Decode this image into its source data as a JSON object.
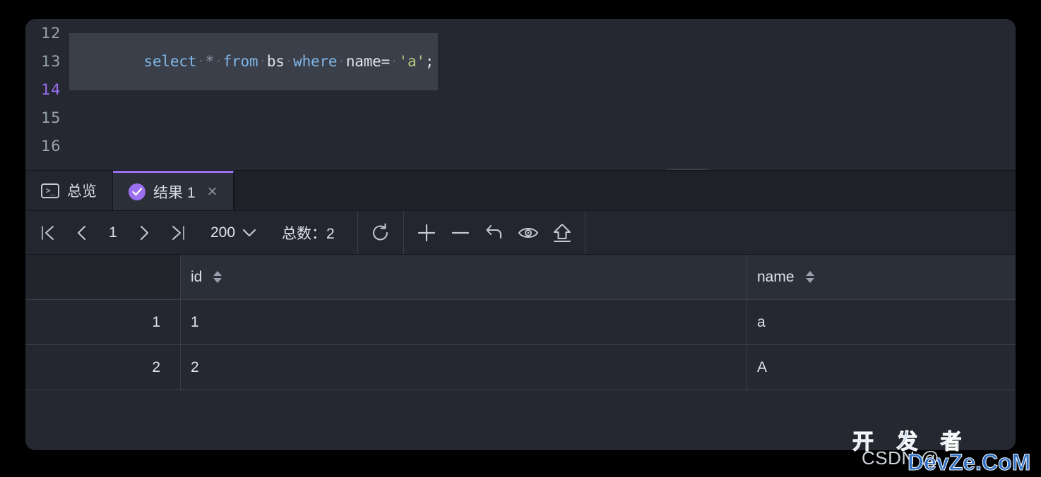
{
  "editor": {
    "lines": [
      {
        "number": "12",
        "current": false,
        "tokens": []
      },
      {
        "number": "13",
        "current": false,
        "highlighted": true,
        "tokens": [
          {
            "t": "select",
            "c": "kw"
          },
          {
            "t": "·",
            "c": "ws"
          },
          {
            "t": "*",
            "c": "op"
          },
          {
            "t": "·",
            "c": "ws"
          },
          {
            "t": "from",
            "c": "kw"
          },
          {
            "t": "·",
            "c": "ws"
          },
          {
            "t": "bs",
            "c": "id"
          },
          {
            "t": "·",
            "c": "ws"
          },
          {
            "t": "where",
            "c": "kw"
          },
          {
            "t": "·",
            "c": "ws"
          },
          {
            "t": "name=",
            "c": "id"
          },
          {
            "t": "·",
            "c": "ws"
          },
          {
            "t": "'a'",
            "c": "str"
          },
          {
            "t": ";",
            "c": "punc"
          }
        ]
      },
      {
        "number": "14",
        "current": true,
        "tokens": []
      },
      {
        "number": "15",
        "current": false,
        "tokens": []
      },
      {
        "number": "16",
        "current": false,
        "tokens": []
      }
    ],
    "sql_text": "select * from bs where name= 'a';",
    "collapse_icon": "chevron-down-icon"
  },
  "tabs": [
    {
      "label": "总览",
      "icon": "terminal-icon",
      "active": false
    },
    {
      "label": "结果 1",
      "icon": "check-circle-icon",
      "active": true,
      "close": "×"
    }
  ],
  "toolbar": {
    "first_page_icon": "first-page-icon",
    "prev_page_icon": "prev-page-icon",
    "page_value": "1",
    "next_page_icon": "next-page-icon",
    "last_page_icon": "last-page-icon",
    "fetch_size": "200",
    "fetch_size_chevron": "chevron-down-icon",
    "total_label": "总数：2",
    "refresh_icon": "refresh-icon",
    "add_row_icon": "plus-icon",
    "delete_row_icon": "minus-icon",
    "undo_icon": "undo-icon",
    "view_icon": "eye-icon",
    "commit_icon": "upload-icon"
  },
  "grid": {
    "columns": [
      {
        "key": "rownum",
        "label": ""
      },
      {
        "key": "id",
        "label": "id",
        "sortable": true
      },
      {
        "key": "name",
        "label": "name",
        "sortable": true
      }
    ],
    "rows": [
      {
        "rownum": "1",
        "id": "1",
        "name": "a"
      },
      {
        "rownum": "2",
        "id": "2",
        "name": "A"
      }
    ]
  },
  "watermark": {
    "csdn": "CSDN @",
    "cn": "开 发 者",
    "en": "DevZe.CoM"
  },
  "colors": {
    "accent_purple": "#9a6ff0",
    "panel_bg": "#252830",
    "tab_bg": "#1e2128",
    "keyword": "#7eb6e8",
    "string": "#b5cc7e",
    "watermark_blue": "#2f6fc4"
  }
}
